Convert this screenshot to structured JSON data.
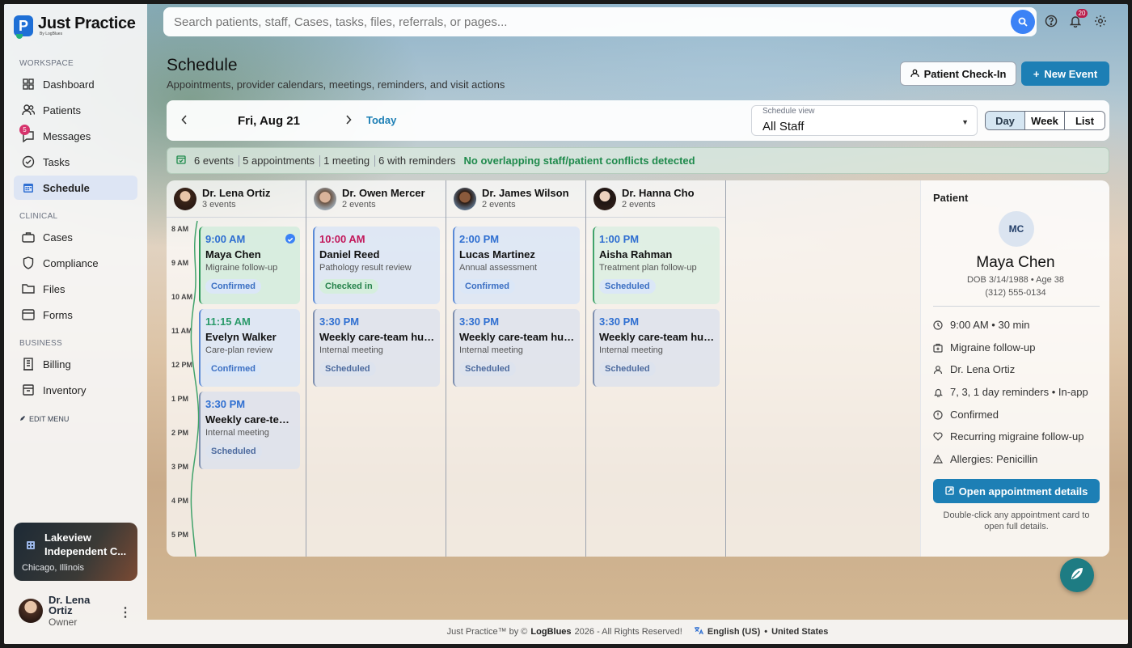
{
  "app": {
    "name": "Just Practice",
    "byline": "By LogBlues"
  },
  "search": {
    "placeholder": "Search patients, staff, Cases, tasks, files, referrals, or pages..."
  },
  "topbar": {
    "notifications_count": "20"
  },
  "sidebar": {
    "sections": {
      "workspace": "WORKSPACE",
      "clinical": "CLINICAL",
      "business": "BUSINESS"
    },
    "items": [
      {
        "label": "Dashboard",
        "icon": "grid-icon"
      },
      {
        "label": "Patients",
        "icon": "users-icon"
      },
      {
        "label": "Messages",
        "icon": "chat-icon",
        "badge": "5"
      },
      {
        "label": "Tasks",
        "icon": "check-circle-icon"
      },
      {
        "label": "Schedule",
        "icon": "calendar-icon",
        "active": true
      },
      {
        "label": "Cases",
        "icon": "briefcase-icon"
      },
      {
        "label": "Compliance",
        "icon": "shield-icon"
      },
      {
        "label": "Files",
        "icon": "folder-icon"
      },
      {
        "label": "Forms",
        "icon": "form-icon"
      },
      {
        "label": "Billing",
        "icon": "building-icon"
      },
      {
        "label": "Inventory",
        "icon": "box-icon"
      }
    ],
    "edit_menu": "EDIT MENU",
    "practice": {
      "name_line1": "Lakeview",
      "name_line2": "Independent C...",
      "location": "Chicago, Illinois"
    },
    "user": {
      "name": "Dr. Lena Ortiz",
      "role": "Owner"
    }
  },
  "header": {
    "title": "Schedule",
    "subtitle": "Appointments, provider calendars, meetings, reminders, and visit actions",
    "checkin_label": "Patient Check-In",
    "new_event_label": "New Event"
  },
  "toolbar": {
    "date": "Fri, Aug 21",
    "today": "Today",
    "view_label": "Schedule view",
    "view_value": "All Staff",
    "modes": [
      "Day",
      "Week",
      "List"
    ],
    "active_mode": "Day"
  },
  "summary": {
    "events": "6 events",
    "appointments": "5 appointments",
    "meetings": "1 meeting",
    "reminders": "6 with reminders",
    "conflicts": "No overlapping staff/patient conflicts detected"
  },
  "hours": [
    "8 AM",
    "9 AM",
    "10 AM",
    "11 AM",
    "12 PM",
    "1 PM",
    "2 PM",
    "3 PM",
    "4 PM",
    "5 PM"
  ],
  "providers": [
    {
      "name": "Dr. Lena Ortiz",
      "count": "3 events",
      "events": [
        {
          "time": "9:00 AM",
          "title": "Maya Chen",
          "sub": "Migraine follow-up",
          "status": "Confirmed",
          "selected": true
        },
        {
          "time": "11:15 AM",
          "title": "Evelyn Walker",
          "sub": "Care-plan review",
          "status": "Confirmed"
        },
        {
          "time": "3:30 PM",
          "title": "Weekly care-team huddle",
          "sub": "Internal meeting",
          "status": "Scheduled"
        }
      ]
    },
    {
      "name": "Dr. Owen Mercer",
      "count": "2 events",
      "events": [
        {
          "time": "10:00 AM",
          "title": "Daniel Reed",
          "sub": "Pathology result review",
          "status": "Checked in"
        },
        {
          "time": "3:30 PM",
          "title": "Weekly care-team huddle",
          "sub": "Internal meeting",
          "status": "Scheduled"
        }
      ]
    },
    {
      "name": "Dr. James Wilson",
      "count": "2 events",
      "events": [
        {
          "time": "2:00 PM",
          "title": "Lucas Martinez",
          "sub": "Annual assessment",
          "status": "Confirmed"
        },
        {
          "time": "3:30 PM",
          "title": "Weekly care-team huddle",
          "sub": "Internal meeting",
          "status": "Scheduled"
        }
      ]
    },
    {
      "name": "Dr. Hanna Cho",
      "count": "2 events",
      "events": [
        {
          "time": "1:00 PM",
          "title": "Aisha Rahman",
          "sub": "Treatment plan follow-up",
          "status": "Scheduled"
        },
        {
          "time": "3:30 PM",
          "title": "Weekly care-team huddle",
          "sub": "Internal meeting",
          "status": "Scheduled"
        }
      ]
    }
  ],
  "patient_panel": {
    "label": "Patient",
    "initials": "MC",
    "name": "Maya Chen",
    "dob": "DOB 3/14/1988 • Age 38",
    "phone": "(312) 555-0134",
    "details": [
      {
        "icon": "clock-icon",
        "text": "9:00 AM • 30 min"
      },
      {
        "icon": "medkit-icon",
        "text": "Migraine follow-up"
      },
      {
        "icon": "person-icon",
        "text": "Dr. Lena Ortiz"
      },
      {
        "icon": "bell-icon",
        "text": "7, 3, 1 day reminders • In-app"
      },
      {
        "icon": "info-icon",
        "text": "Confirmed"
      },
      {
        "icon": "heart-icon",
        "text": "Recurring migraine follow-up"
      },
      {
        "icon": "warning-icon",
        "text": "Allergies: Penicillin"
      }
    ],
    "open_label": "Open appointment details",
    "hint": "Double-click any appointment card to open full details."
  },
  "footer": {
    "copyright_prefix": "Just Practice™ by ©",
    "brand": "LogBlues",
    "copyright_suffix": "2026 - All Rights Reserved!",
    "language": "English (US)",
    "region": "United States"
  },
  "colors": {
    "accent": "#1d7fb5",
    "confirmed": "#3b6fc3",
    "checked_in": "#26824b",
    "scheduled": "#4c6a9e",
    "time_blue": "#2f6fd1",
    "time_pink": "#c2185b"
  }
}
